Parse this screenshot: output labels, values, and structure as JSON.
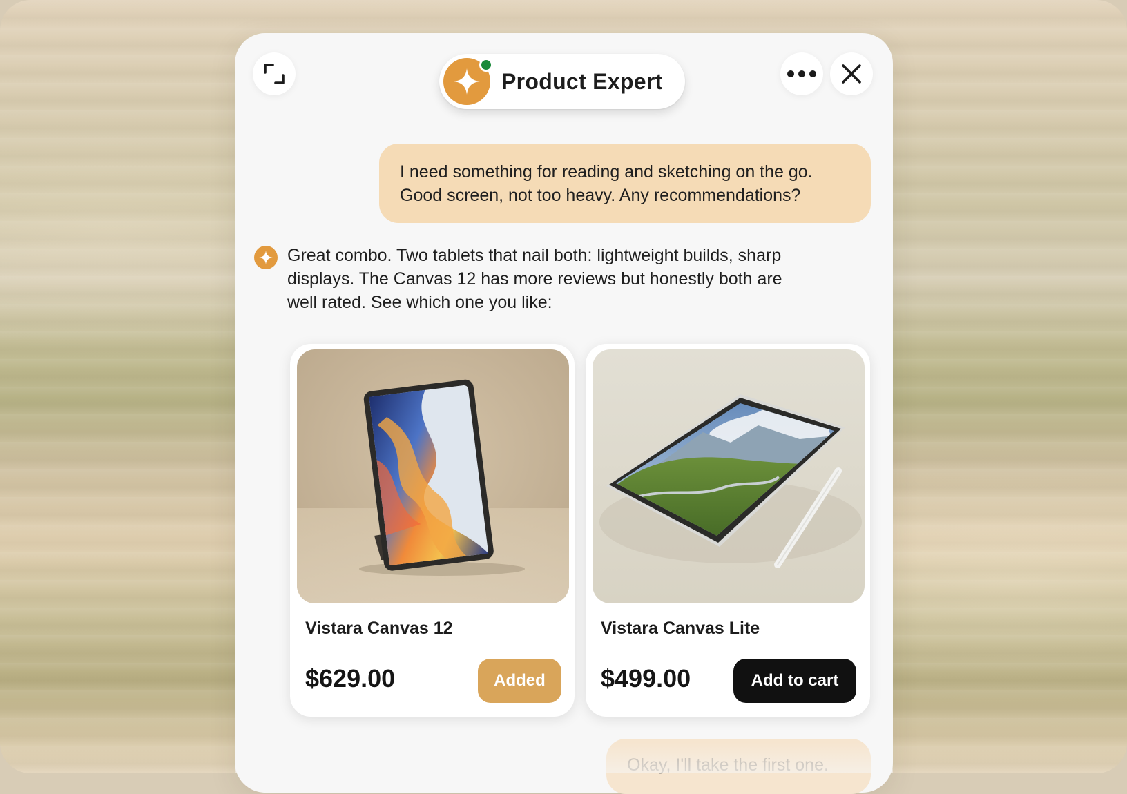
{
  "header": {
    "agent_name": "Product Expert",
    "status": "online",
    "icons": {
      "expand": "expand-icon",
      "more": "more-options-icon",
      "close": "close-icon",
      "agent": "sparkle-icon"
    }
  },
  "conversation": {
    "user_message": {
      "lines": [
        "I need something for reading and sketching on the go.",
        "Good screen, not too heavy. Any recommendations?"
      ]
    },
    "assistant_message": {
      "lines": [
        "Great combo. Two tablets that nail both: lightweight builds, sharp",
        "displays. The Canvas 12 has more reviews but honestly both are",
        "well rated. See which one you like:"
      ]
    },
    "products": [
      {
        "name": "Vistara Canvas 12",
        "price": "$629.00",
        "button_label": "Added",
        "button_state": "added"
      },
      {
        "name": "Vistara Canvas Lite",
        "price": "$499.00",
        "button_label": "Add to cart",
        "button_state": "default"
      }
    ],
    "user_message_2": {
      "text": "Okay, I'll take the first one."
    }
  },
  "colors": {
    "accent": "#e29a3e",
    "user_bubble": "#f5dbb6",
    "added_button": "#d9a55a",
    "cart_button": "#111111",
    "online": "#1a8a3a"
  }
}
